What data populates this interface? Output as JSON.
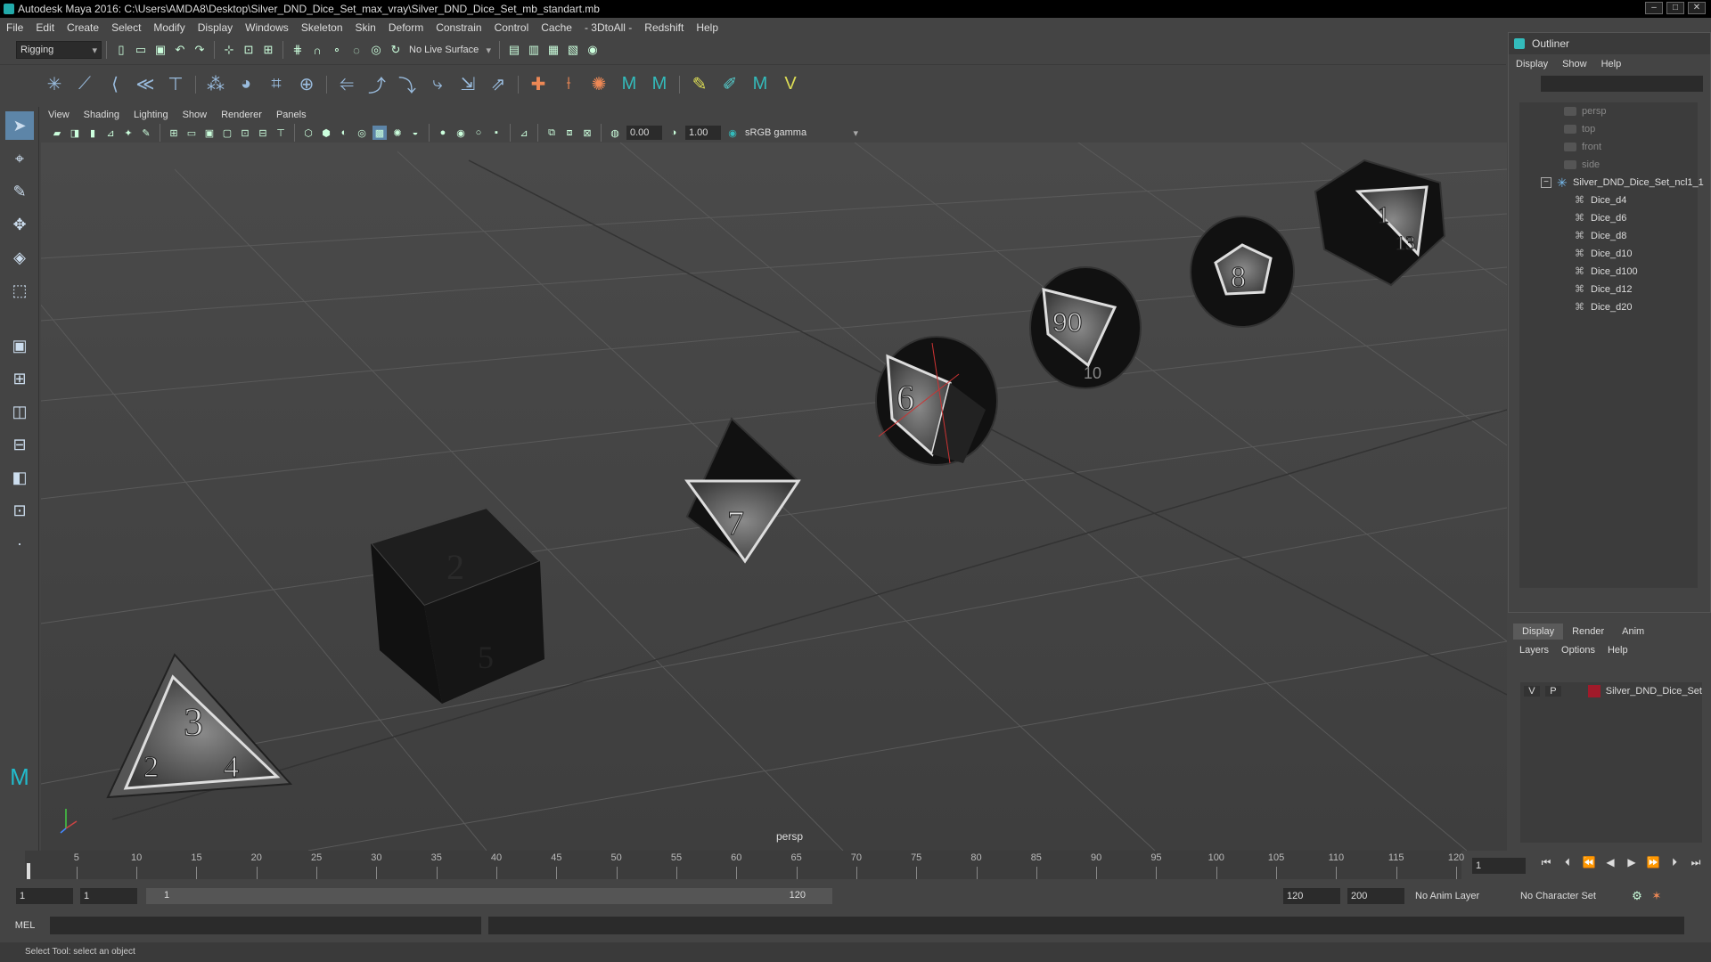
{
  "window": {
    "title": "Autodesk Maya 2016: C:\\Users\\AMDA8\\Desktop\\Silver_DND_Dice_Set_max_vray\\Silver_DND_Dice_Set_mb_standart.mb"
  },
  "menubar": [
    "File",
    "Edit",
    "Create",
    "Select",
    "Modify",
    "Display",
    "Windows",
    "Skeleton",
    "Skin",
    "Deform",
    "Constrain",
    "Control",
    "Cache",
    "- 3DtoAll -",
    "Redshift",
    "Help"
  ],
  "shelf": {
    "mode": "Rigging",
    "live_surface": "No Live Surface"
  },
  "viewport": {
    "menus": [
      "View",
      "Shading",
      "Lighting",
      "Show",
      "Renderer",
      "Panels"
    ],
    "exposure": "0.00",
    "gamma": "1.00",
    "color_space": "sRGB gamma",
    "camera_label": "persp",
    "dice_numbers": {
      "d4": [
        "3",
        "2",
        "4"
      ],
      "d6": [
        "2",
        "5"
      ],
      "d8": "7",
      "d10": "6",
      "d100": [
        "90",
        "10"
      ],
      "d12": "8",
      "d20": [
        "1",
        "13"
      ]
    }
  },
  "outliner": {
    "title": "Outliner",
    "menus": [
      "Display",
      "Show",
      "Help"
    ],
    "cameras": [
      "persp",
      "top",
      "front",
      "side"
    ],
    "group": "Silver_DND_Dice_Set_ncl1_1",
    "children": [
      "Dice_d4",
      "Dice_d6",
      "Dice_d8",
      "Dice_d10",
      "Dice_d100",
      "Dice_d12",
      "Dice_d20"
    ]
  },
  "layers": {
    "tabs": [
      "Display",
      "Render",
      "Anim"
    ],
    "menus": [
      "Layers",
      "Options",
      "Help"
    ],
    "rows": [
      {
        "v": "V",
        "p": "P",
        "name": "Silver_DND_Dice_Set",
        "color": "#a01a2a"
      }
    ]
  },
  "timeline": {
    "ticks": [
      "1",
      "5",
      "10",
      "15",
      "20",
      "25",
      "30",
      "35",
      "40",
      "45",
      "50",
      "55",
      "60",
      "65",
      "70",
      "75",
      "80",
      "85",
      "90",
      "95",
      "100",
      "105",
      "110",
      "115",
      "120"
    ],
    "current_frame": "1"
  },
  "range": {
    "start": "1",
    "play_start": "1",
    "slider_start": "1",
    "slider_end": "120",
    "play_end": "120",
    "end": "200",
    "anim_layer": "No Anim Layer",
    "char_set": "No Character Set"
  },
  "cmd": {
    "label": "MEL"
  },
  "status": "Select Tool: select an object"
}
